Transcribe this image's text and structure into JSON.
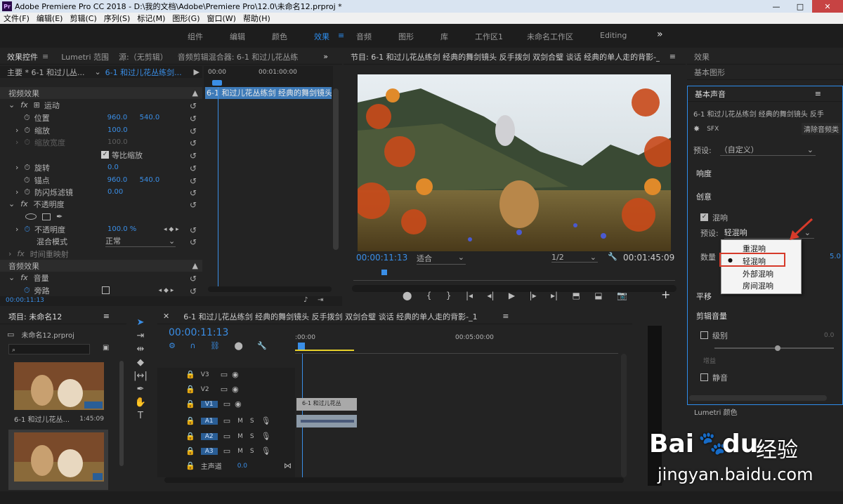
{
  "title_bar": {
    "text": "Adobe Premiere Pro CC 2018 - D:\\我的文档\\Adobe\\Premiere Pro\\12.0\\未命名12.prproj *",
    "app_icon": "Pr"
  },
  "window_controls": {
    "minimize": "—",
    "maximize": "□",
    "close": "✕"
  },
  "menu": [
    "文件(F)",
    "编辑(E)",
    "剪辑(C)",
    "序列(S)",
    "标记(M)",
    "图形(G)",
    "窗口(W)",
    "帮助(H)"
  ],
  "workspaces": [
    "组件",
    "编辑",
    "颜色",
    "效果",
    "音频",
    "图形",
    "库",
    "工作区1",
    "未命名工作区",
    "Editing"
  ],
  "workspace_overflow": "»",
  "left_panel": {
    "tabs": [
      "效果控件",
      "Lumetri 范围",
      "源:（无剪辑）",
      "音频剪辑混合器: 6-1 和过儿花丛练"
    ],
    "master": "主要 * 6-1 和过儿丛...",
    "clip_sel": "6-1 和过儿花丛练剑...",
    "mini_clip": "6-1 和过儿花丛练剑 经典的舞剑镜头",
    "ruler": [
      "00:00",
      "00:01:00:00"
    ],
    "video_effects": "视频效果",
    "motion": "运动",
    "position": {
      "label": "位置",
      "x": "960.0",
      "y": "540.0"
    },
    "scale": {
      "label": "缩放",
      "v": "100.0"
    },
    "scale_width": {
      "label": "缩放宽度",
      "v": "100.0"
    },
    "uniform": "等比缩放",
    "rotation": {
      "label": "旋转",
      "v": "0.0"
    },
    "anchor": {
      "label": "锚点",
      "x": "960.0",
      "y": "540.0"
    },
    "flicker": {
      "label": "防闪烁滤镜",
      "v": "0.00"
    },
    "opacity_group": "不透明度",
    "opacity": {
      "label": "不透明度",
      "v": "100.0 %"
    },
    "blend": {
      "label": "混合模式",
      "v": "正常"
    },
    "time_remap": "时间重映射",
    "audio_effects": "音频效果",
    "volume": "音量",
    "bypass": "旁路",
    "timecode": "00:00:11:13"
  },
  "program": {
    "title": "节目: 6-1 和过儿花丛练剑 经典的舞剑镜头 反手拨剑 双剑合璧 谈话 经典的单人走的背影-_1",
    "menu_icon": "≡",
    "timecode": "00:00:11:13",
    "fit": "适合",
    "quality": "1/2",
    "duration": "00:01:45:09"
  },
  "project": {
    "title": "项目: 未命名12",
    "file": "未命名12.prproj",
    "items": [
      {
        "name": "6-1 和过儿花丛...",
        "dur": "1:45:09"
      }
    ]
  },
  "timeline": {
    "title": "6-1 和过儿花丛练剑 经典的舞剑镜头 反手拨剑 双剑合璧 谈话 经典的单人走的背影-_1",
    "timecode": "00:00:11:13",
    "ruler": [
      ":00:00",
      "00:05:00:00"
    ],
    "tracks": [
      "V3",
      "V2",
      "V1",
      "A1",
      "A2",
      "A3"
    ],
    "master": "主声道",
    "master_val": "0.0",
    "clip_label": "6-1 和过儿花丛",
    "track_btns": {
      "m": "M",
      "s": "S"
    }
  },
  "right_panel": {
    "tabs": [
      "效果",
      "基本图形",
      "基本声音"
    ],
    "clip": "6-1 和过儿花丛练剑 经典的舞剑镜头 反手",
    "sfx": "SFX",
    "clear": "清除音频类",
    "preset_label": "预设:",
    "preset_val": "（自定义）",
    "loudness": "响度",
    "creative": "创意",
    "reverb": "混响",
    "reverb_preset_label": "预设:",
    "reverb_preset_val": "轻混响",
    "amount": "数量",
    "amount_val": "5.0",
    "dropdown": [
      "重混响",
      "轻混响",
      "外部混响",
      "房间混响"
    ],
    "selected": 1,
    "pan": "平移",
    "clip_volume": "剪辑音量",
    "level": "级别",
    "level_val": "0.0",
    "gain": "增益",
    "mute": "静音",
    "lumetri": "Lumetri 颜色"
  },
  "watermark": {
    "brand": "Bai",
    "brand2": "du",
    "cn": "经验",
    "url": "jingyan.baidu.com"
  },
  "colors": {
    "accent": "#2d8ceb",
    "red_box": "#d63a2a"
  }
}
